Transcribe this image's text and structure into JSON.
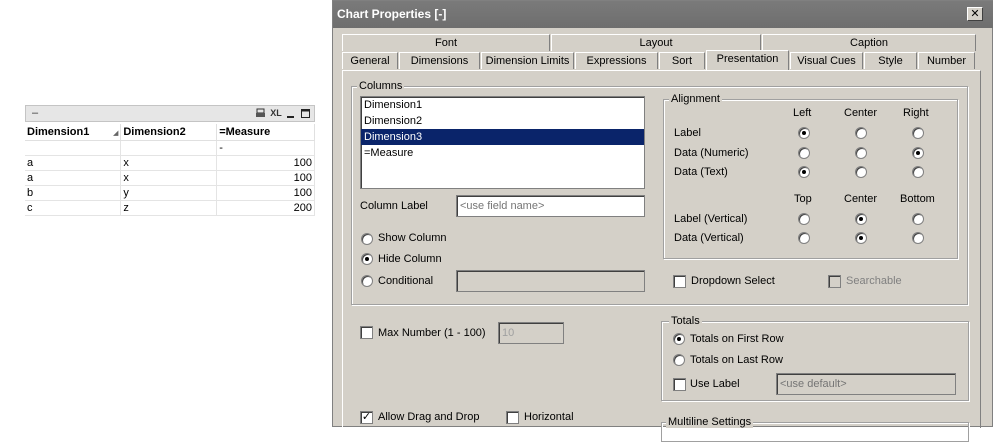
{
  "table": {
    "caption_dash": "–",
    "caption_icons": [
      "print-icon",
      "xl-icon",
      "minimize-icon",
      "maximize-icon"
    ],
    "xl_label": "XL",
    "headers": [
      "Dimension1",
      "Dimension2",
      "=Measure"
    ],
    "total_row": [
      "",
      "",
      "-"
    ],
    "rows": [
      [
        "a",
        "x",
        "100"
      ],
      [
        "a",
        "x",
        "100"
      ],
      [
        "b",
        "y",
        "100"
      ],
      [
        "c",
        "z",
        "200"
      ]
    ]
  },
  "dialog": {
    "title": "Chart Properties [-]",
    "close_label": "✕",
    "tabs_row1": [
      "Font",
      "Layout",
      "Caption"
    ],
    "tabs_row2": [
      "General",
      "Dimensions",
      "Dimension Limits",
      "Expressions",
      "Sort",
      "Presentation",
      "Visual Cues",
      "Style",
      "Number"
    ],
    "active_tab": "Presentation",
    "columns": {
      "legend": "Columns",
      "items": [
        "Dimension1",
        "Dimension2",
        "Dimension3",
        "=Measure"
      ],
      "selected": "Dimension3",
      "column_label": "Column Label",
      "column_label_placeholder": "<use field name>",
      "show_column": "Show Column",
      "hide_column": "Hide Column",
      "conditional": "Conditional",
      "visibility_selected": "Hide Column"
    },
    "alignment": {
      "legend": "Alignment",
      "h_headers": [
        "Left",
        "Center",
        "Right"
      ],
      "h_rows": [
        {
          "label": "Label",
          "selected": "Left"
        },
        {
          "label": "Data (Numeric)",
          "selected": "Right"
        },
        {
          "label": "Data (Text)",
          "selected": "Left"
        }
      ],
      "v_headers": [
        "Top",
        "Center",
        "Bottom"
      ],
      "v_rows": [
        {
          "label": "Label (Vertical)",
          "selected": "Center"
        },
        {
          "label": "Data (Vertical)",
          "selected": "Center"
        }
      ]
    },
    "dropdown_select": "Dropdown Select",
    "searchable": "Searchable",
    "max_number": "Max Number (1 - 100)",
    "max_number_value": "10",
    "totals": {
      "legend": "Totals",
      "first_row": "Totals on First Row",
      "last_row": "Totals on Last Row",
      "use_label": "Use Label",
      "use_label_placeholder": "<use default>",
      "selected": "Totals on First Row"
    },
    "allow_drag_drop": "Allow Drag and Drop",
    "allow_drag_drop_checked": true,
    "horizontal": "Horizontal",
    "multiline_legend": "Multiline Settings"
  }
}
